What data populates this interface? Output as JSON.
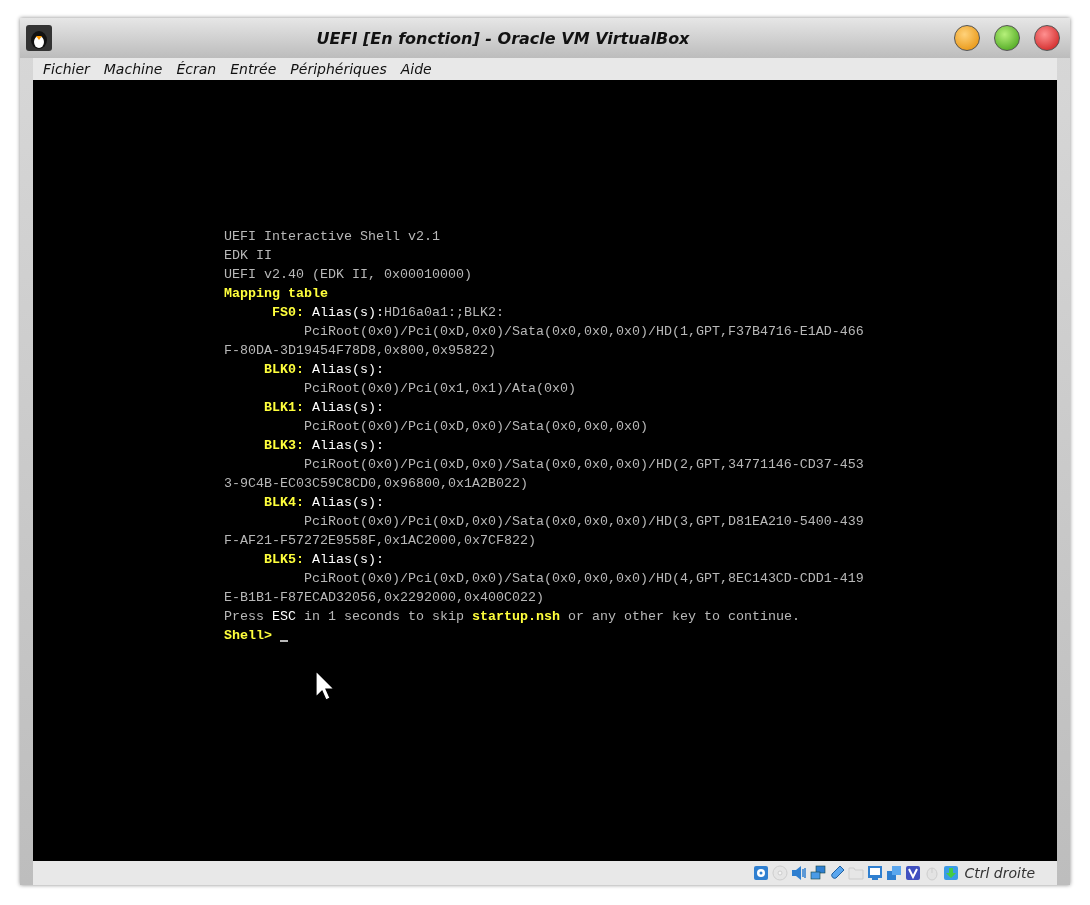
{
  "window": {
    "title": "UEFI [En fonction] - Oracle VM VirtualBox"
  },
  "menu": [
    "Fichier",
    "Machine",
    "Écran",
    "Entrée",
    "Périphériques",
    "Aide"
  ],
  "console": {
    "lines": [
      [
        {
          "text": "UEFI Interactive Shell v2.1",
          "color": "#b8b8b8"
        }
      ],
      [
        {
          "text": "EDK II",
          "color": "#b8b8b8"
        }
      ],
      [
        {
          "text": "UEFI v2.40 (EDK II, 0x00010000)",
          "color": "#b8b8b8"
        }
      ],
      [
        {
          "text": "Mapping table",
          "color": "#ffff3c"
        }
      ],
      [
        {
          "text": "      FS0:",
          "color": "#ffff3c"
        },
        {
          "text": " Alias(s):",
          "color": "#ffffff"
        },
        {
          "text": "HD16a0a1:;BLK2:",
          "color": "#b8b8b8"
        }
      ],
      [
        {
          "text": "          PciRoot(0x0)/Pci(0xD,0x0)/Sata(0x0,0x0,0x0)/HD(1,GPT,F37B4716-E1AD-466",
          "color": "#b8b8b8"
        }
      ],
      [
        {
          "text": "F-80DA-3D19454F78D8,0x800,0x95822)",
          "color": "#b8b8b8"
        }
      ],
      [
        {
          "text": "     BLK0:",
          "color": "#ffff3c"
        },
        {
          "text": " Alias(s):",
          "color": "#ffffff"
        }
      ],
      [
        {
          "text": "          PciRoot(0x0)/Pci(0x1,0x1)/Ata(0x0)",
          "color": "#b8b8b8"
        }
      ],
      [
        {
          "text": "     BLK1:",
          "color": "#ffff3c"
        },
        {
          "text": " Alias(s):",
          "color": "#ffffff"
        }
      ],
      [
        {
          "text": "          PciRoot(0x0)/Pci(0xD,0x0)/Sata(0x0,0x0,0x0)",
          "color": "#b8b8b8"
        }
      ],
      [
        {
          "text": "     BLK3:",
          "color": "#ffff3c"
        },
        {
          "text": " Alias(s):",
          "color": "#ffffff"
        }
      ],
      [
        {
          "text": "          PciRoot(0x0)/Pci(0xD,0x0)/Sata(0x0,0x0,0x0)/HD(2,GPT,34771146-CD37-453",
          "color": "#b8b8b8"
        }
      ],
      [
        {
          "text": "3-9C4B-EC03C59C8CD0,0x96800,0x1A2B022)",
          "color": "#b8b8b8"
        }
      ],
      [
        {
          "text": "     BLK4:",
          "color": "#ffff3c"
        },
        {
          "text": " Alias(s):",
          "color": "#ffffff"
        }
      ],
      [
        {
          "text": "          PciRoot(0x0)/Pci(0xD,0x0)/Sata(0x0,0x0,0x0)/HD(3,GPT,D81EA210-5400-439",
          "color": "#b8b8b8"
        }
      ],
      [
        {
          "text": "F-AF21-F57272E9558F,0x1AC2000,0x7CF822)",
          "color": "#b8b8b8"
        }
      ],
      [
        {
          "text": "     BLK5:",
          "color": "#ffff3c"
        },
        {
          "text": " Alias(s):",
          "color": "#ffffff"
        }
      ],
      [
        {
          "text": "          PciRoot(0x0)/Pci(0xD,0x0)/Sata(0x0,0x0,0x0)/HD(4,GPT,8EC143CD-CDD1-419",
          "color": "#b8b8b8"
        }
      ],
      [
        {
          "text": "E-B1B1-F87ECAD32056,0x2292000,0x400C022)",
          "color": "#b8b8b8"
        }
      ],
      [
        {
          "text": "Press ",
          "color": "#b8b8b8"
        },
        {
          "text": "ESC",
          "color": "#ffffff"
        },
        {
          "text": " in 1 seconds to skip ",
          "color": "#b8b8b8"
        },
        {
          "text": "startup.nsh",
          "color": "#ffff3c"
        },
        {
          "text": " or any other key to continue.",
          "color": "#b8b8b8"
        }
      ]
    ],
    "prompt": "Shell>"
  },
  "status_bar": {
    "icons": [
      {
        "kind": "disk",
        "disabled": false
      },
      {
        "kind": "disc",
        "disabled": true
      },
      {
        "kind": "speaker",
        "disabled": false
      },
      {
        "kind": "network",
        "disabled": false
      },
      {
        "kind": "usb",
        "disabled": false
      },
      {
        "kind": "folder",
        "disabled": true
      },
      {
        "kind": "monitor",
        "disabled": false
      },
      {
        "kind": "windows",
        "disabled": false
      },
      {
        "kind": "v",
        "disabled": false
      },
      {
        "kind": "mouse",
        "disabled": true
      },
      {
        "kind": "download",
        "disabled": false
      }
    ],
    "host_key": "Ctrl droite"
  }
}
